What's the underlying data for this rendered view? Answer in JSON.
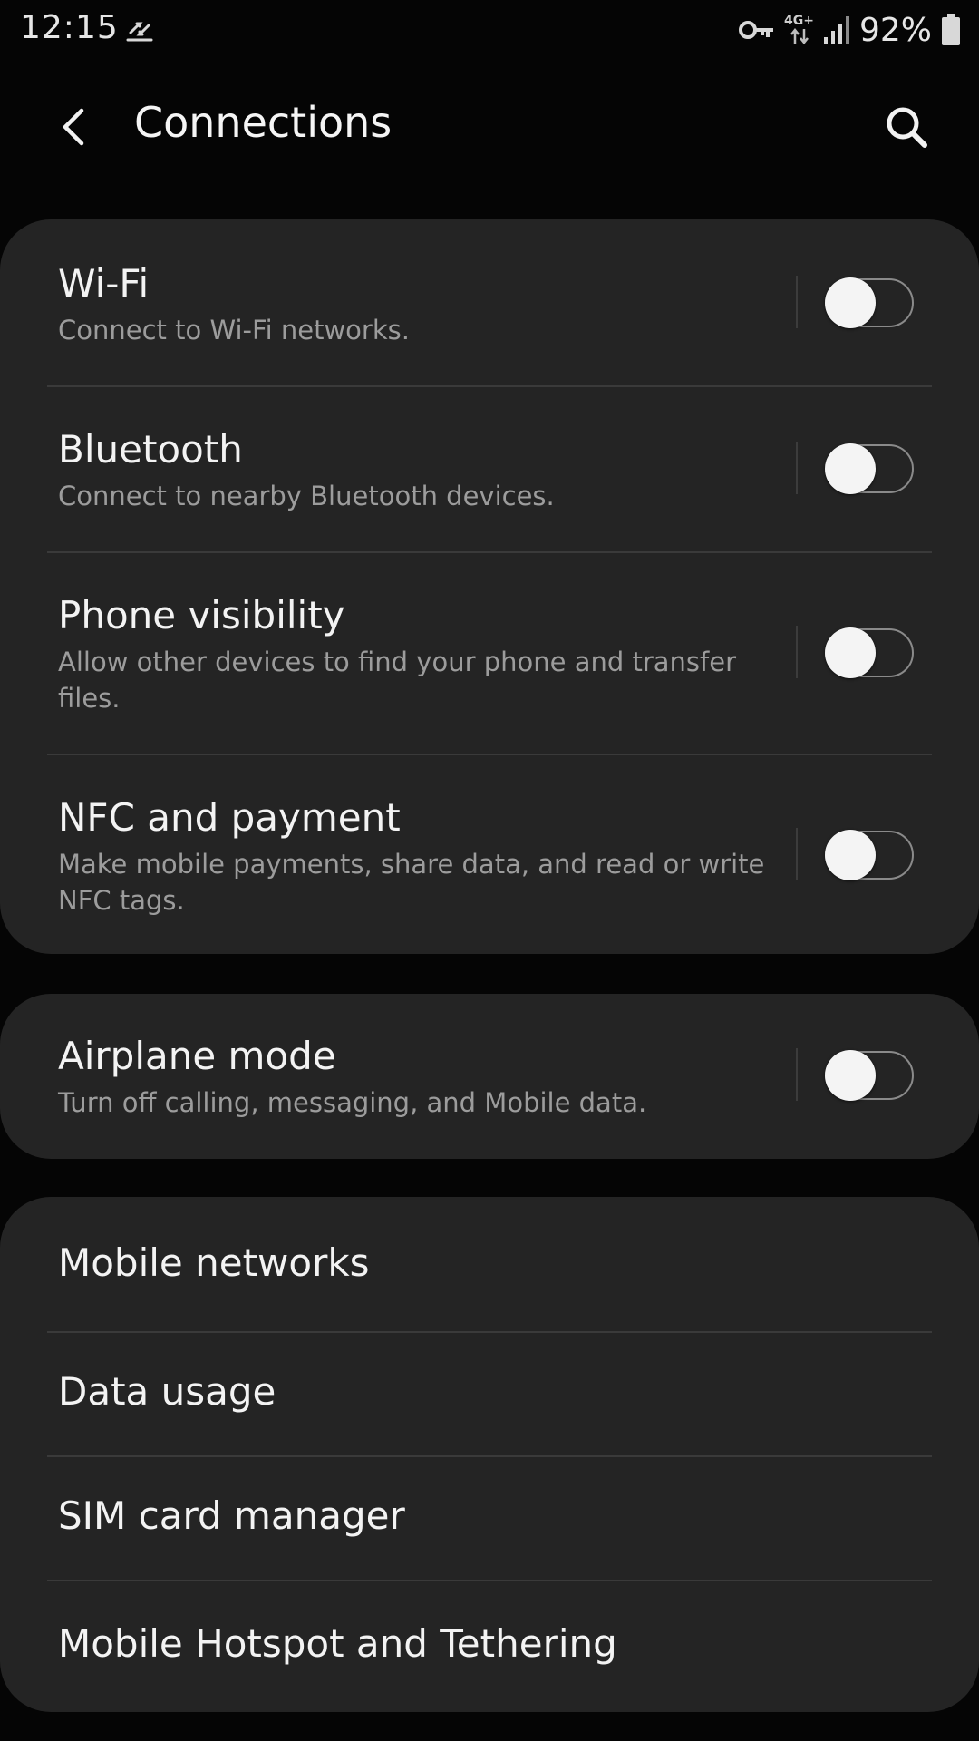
{
  "status_bar": {
    "time": "12:15",
    "network_type": "4G+",
    "battery": "92%",
    "icons": [
      "sync-icon",
      "vpn-key-icon",
      "network-data-icon",
      "signal-icon",
      "battery-icon"
    ]
  },
  "header": {
    "title": "Connections",
    "back_icon": "chevron-left-icon",
    "search_icon": "search-icon"
  },
  "colors": {
    "background": "#050505",
    "card": "#242424",
    "title_text": "#f3f3f3",
    "subtitle_text": "#9c9c9c",
    "toggle_knob": "#f4f4f4",
    "toggle_track_border": "#8a8a8a"
  },
  "cards": [
    {
      "rows": [
        {
          "title": "Wi-Fi",
          "subtitle": "Connect to Wi-Fi networks.",
          "toggle_on": false
        },
        {
          "title": "Bluetooth",
          "subtitle": "Connect to nearby Bluetooth devices.",
          "toggle_on": false
        },
        {
          "title": "Phone visibility",
          "subtitle": "Allow other devices to find your phone and transfer files.",
          "toggle_on": false
        },
        {
          "title": "NFC and payment",
          "subtitle": "Make mobile payments, share data, and read or write NFC tags.",
          "toggle_on": false
        }
      ]
    },
    {
      "rows": [
        {
          "title": "Airplane mode",
          "subtitle": "Turn off calling, messaging, and Mobile data.",
          "toggle_on": false
        }
      ]
    },
    {
      "rows": [
        {
          "title": "Mobile networks"
        },
        {
          "title": "Data usage"
        },
        {
          "title": "SIM card manager"
        },
        {
          "title": "Mobile Hotspot and Tethering"
        }
      ]
    }
  ]
}
